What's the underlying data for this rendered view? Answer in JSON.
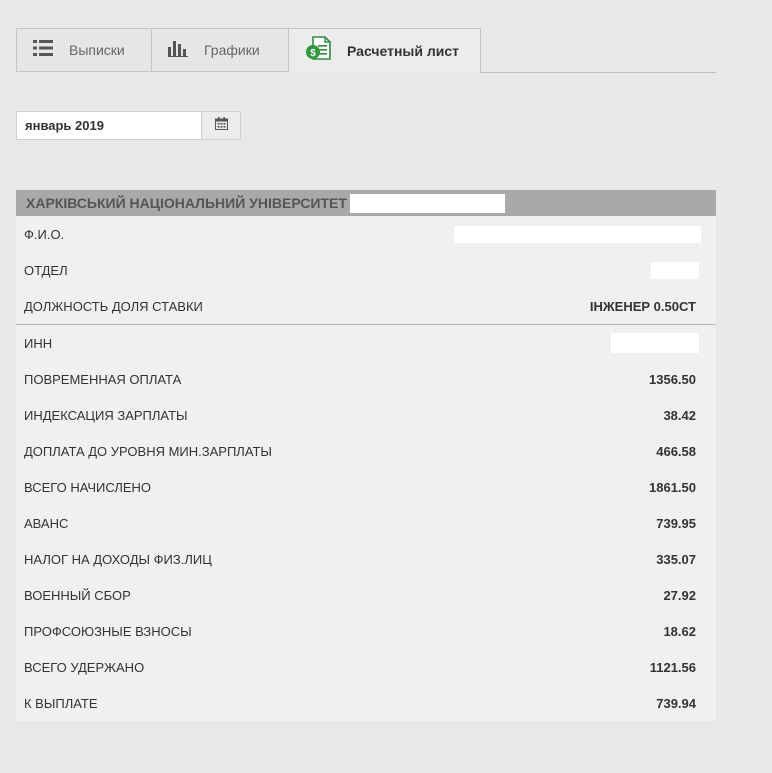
{
  "tabs": [
    {
      "label": "Выписки",
      "icon": "list-icon"
    },
    {
      "label": "Графики",
      "icon": "bar-chart-icon"
    },
    {
      "label": "Расчетный лист",
      "icon": "payslip-money-icon"
    }
  ],
  "date": {
    "value": "январь 2019"
  },
  "sheet": {
    "organization": "ХАРКІВСЬКИЙ НАЦІОНАЛЬНИЙ УНІВЕРСИТЕТ",
    "info_rows": [
      {
        "label": "Ф.И.О.",
        "value": ""
      },
      {
        "label": "ОТДЕЛ",
        "value": ""
      },
      {
        "label": "ДОЛЖНОСТЬ ДОЛЯ СТАВКИ",
        "value": "ІНЖЕНЕР 0.50СТ"
      }
    ],
    "pay_rows": [
      {
        "label": "ИНН",
        "value": ""
      },
      {
        "label": "ПОВРЕМЕННАЯ ОПЛАТА",
        "value": "1356.50"
      },
      {
        "label": "ИНДЕКСАЦИЯ ЗАРПЛАТЫ",
        "value": "38.42"
      },
      {
        "label": "ДОПЛАТА ДО УРОВНЯ МИН.ЗАРПЛАТЫ",
        "value": "466.58"
      },
      {
        "label": "ВСЕГО НАЧИСЛЕНО",
        "value": "1861.50"
      },
      {
        "label": "АВАНС",
        "value": "739.95"
      },
      {
        "label": "НАЛОГ НА ДОХОДЫ ФИЗ.ЛИЦ",
        "value": "335.07"
      },
      {
        "label": "ВОЕННЫЙ СБОР",
        "value": "27.92"
      },
      {
        "label": "ПРОФСОЮЗНЫЕ ВЗНОСЫ",
        "value": "18.62"
      },
      {
        "label": "ВСЕГО УДЕРЖАНО",
        "value": "1121.56"
      },
      {
        "label": "К ВЫПЛАТЕ",
        "value": "739.94"
      }
    ]
  }
}
